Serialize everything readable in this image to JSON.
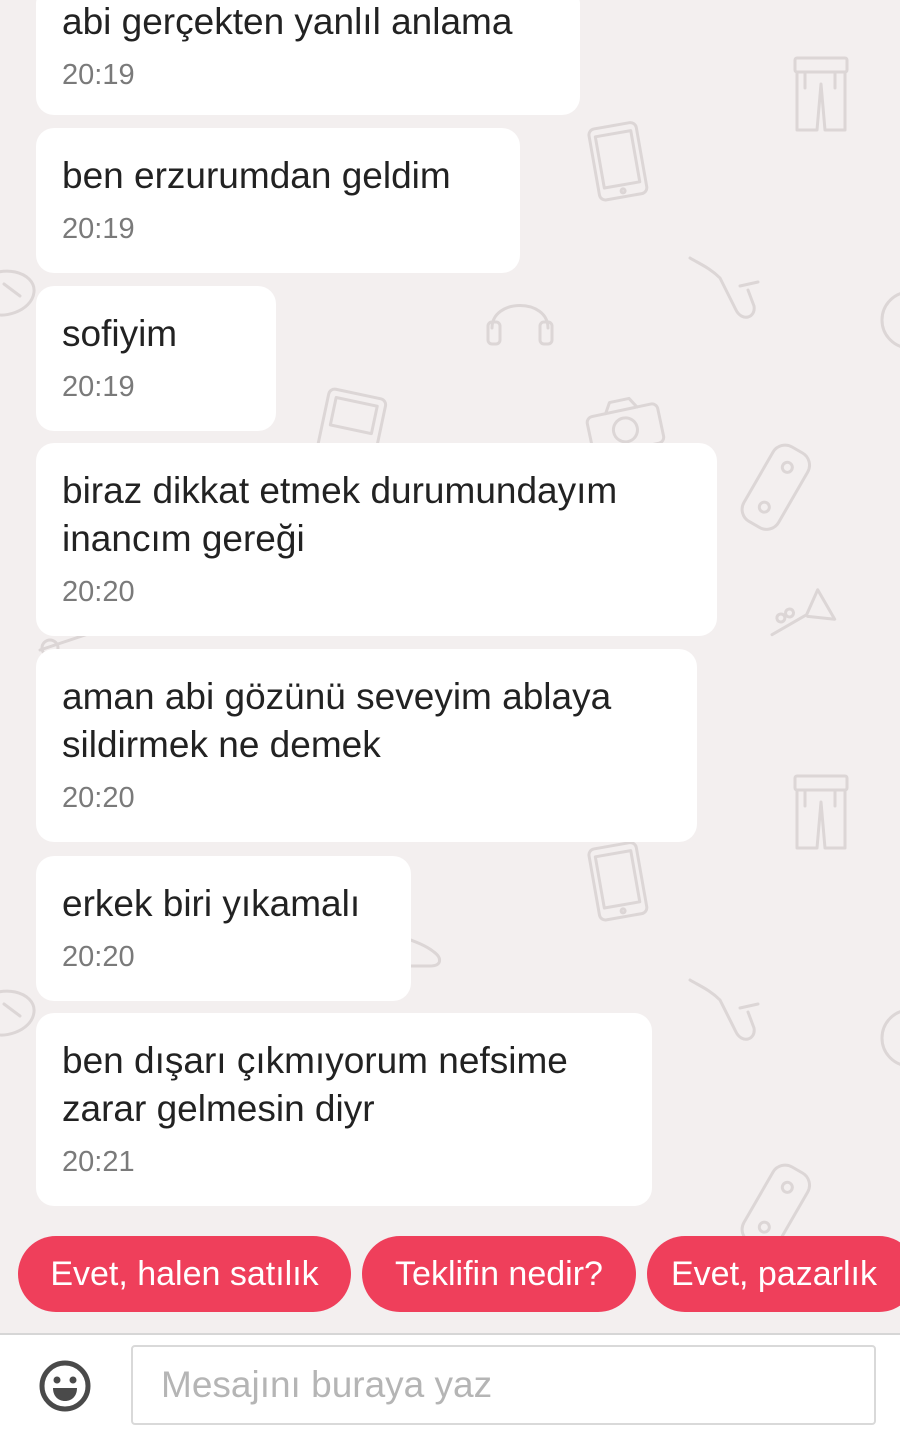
{
  "messages": [
    {
      "text": "abi gerçekten yanlıl anlama",
      "time": "20:19"
    },
    {
      "text": "ben erzurumdan geldim",
      "time": "20:19"
    },
    {
      "text": "sofiyim",
      "time": "20:19"
    },
    {
      "text": "biraz dikkat etmek durumundayım\ninancım gereği",
      "time": "20:20"
    },
    {
      "text": "aman abi gözünü seveyim ablaya\nsildirmek ne demek",
      "time": "20:20"
    },
    {
      "text": "erkek biri yıkamalı",
      "time": "20:20"
    },
    {
      "text": "ben dışarı çıkmıyorum nefsime\nzarar gelmesin diyr",
      "time": "20:21"
    }
  ],
  "quick_replies": [
    "Evet, halen satılık",
    "Teklifin nedir?",
    "Evet, pazarlık"
  ],
  "composer": {
    "placeholder": "Mesajını buraya yaz",
    "emoji_icon": "smiley-face-icon"
  },
  "colors": {
    "chat_background": "#f3efef",
    "bubble": "#ffffff",
    "accent": "#ef3f5b",
    "timestamp": "#7a7a7a",
    "doodle": "#dcd6d6"
  }
}
